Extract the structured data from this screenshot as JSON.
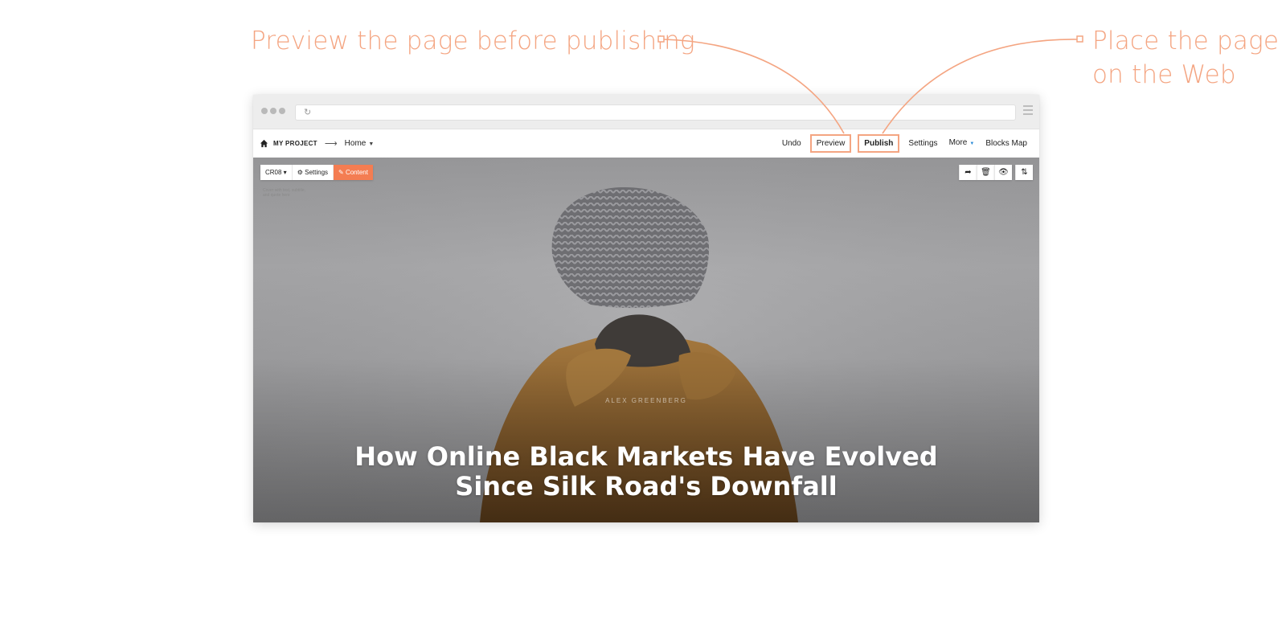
{
  "callouts": {
    "preview": "Preview the page before publishing",
    "publish_line1": "Place the page",
    "publish_line2": "on the Web"
  },
  "colors": {
    "accent": "#f4a582",
    "content_button": "#f47d52"
  },
  "browser": {
    "menu_icon": "hamburger-menu-icon",
    "reload_icon": "reload-icon"
  },
  "appbar": {
    "home_icon": "home-icon",
    "project": "MY PROJECT",
    "page": "Home",
    "undo": "Undo",
    "preview": "Preview",
    "publish": "Publish",
    "settings": "Settings",
    "more": "More",
    "blocks_map": "Blocks Map"
  },
  "block_toolbar": {
    "block_id": "CR08",
    "settings": "Settings",
    "content": "Content",
    "icons": [
      "share-icon",
      "trash-icon",
      "eye-icon",
      "reorder-icon"
    ]
  },
  "hero": {
    "ghost_text": "Cover with text, subtitle, and quote here",
    "author": "ALEX GREENBERG",
    "headline_line1": "How Online Black Markets Have Evolved",
    "headline_line2": "Since Silk Road's Downfall"
  }
}
